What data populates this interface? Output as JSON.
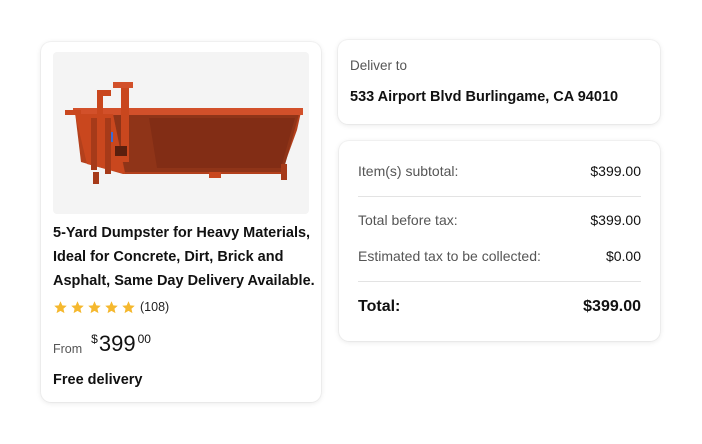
{
  "product": {
    "image_alt": "dumpster-image",
    "title": "5-Yard Dumpster for Heavy Materials, Ideal for Concrete, Dirt, Brick and Asphalt, Same Day Delivery Available.",
    "rating": 5,
    "review_count": "(108)",
    "price_prefix": "From",
    "currency": "$",
    "price_whole": "399",
    "price_cents": "00",
    "delivery": "Free delivery"
  },
  "deliver": {
    "label": "Deliver to",
    "address": "533 Airport Blvd Burlingame, CA 94010"
  },
  "summary": {
    "subtotal_label": "Item(s) subtotal:",
    "subtotal_value": "$399.00",
    "before_tax_label": "Total before tax:",
    "before_tax_value": "$399.00",
    "tax_label": "Estimated tax to be collected:",
    "tax_value": "$0.00",
    "total_label": "Total:",
    "total_value": "$399.00"
  },
  "colors": {
    "star": "#f5b82e",
    "dumpster": "#c9471e",
    "dumpster_dark": "#8a2e17"
  }
}
